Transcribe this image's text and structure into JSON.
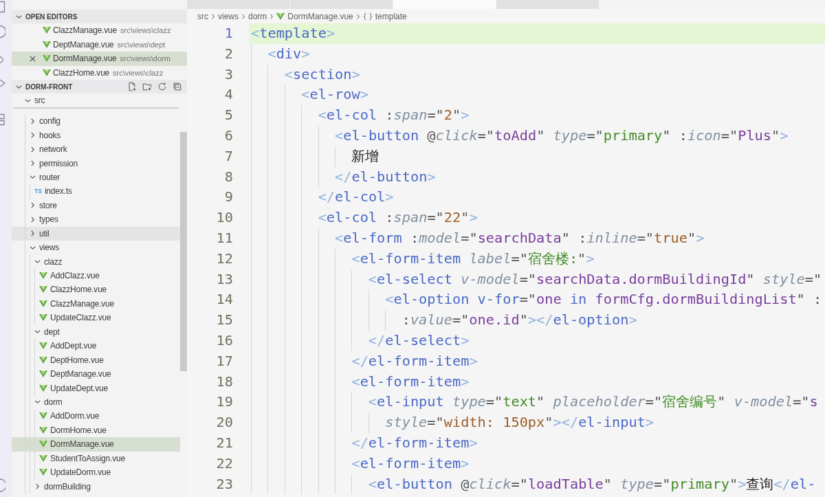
{
  "explorer": {
    "open_editors": {
      "title": "OPEN EDITORS",
      "expanded": true,
      "items": [
        {
          "kind": "vue",
          "name": "ClazzManage.vue",
          "path": "src\\views\\clazz",
          "selected": false
        },
        {
          "kind": "vue",
          "name": "DeptManage.vue",
          "path": "src\\views\\dept",
          "selected": false
        },
        {
          "kind": "vue",
          "name": "DormManage.vue",
          "path": "src\\views\\dorm",
          "selected": true
        },
        {
          "kind": "vue",
          "name": "ClazzHome.vue",
          "path": "src\\views\\clazz",
          "selected": false
        }
      ]
    },
    "project": {
      "title": "DORM-FRONT",
      "expanded": true,
      "tree": [
        {
          "kind": "folder",
          "name": "src",
          "expanded": true,
          "selected": false,
          "hovered": false,
          "children": [
            {
              "kind": "folder",
              "name": "config",
              "expanded": false,
              "selected": false,
              "hovered": false
            },
            {
              "kind": "folder",
              "name": "hooks",
              "expanded": false,
              "selected": false,
              "hovered": false
            },
            {
              "kind": "folder",
              "name": "network",
              "expanded": false,
              "selected": false,
              "hovered": false
            },
            {
              "kind": "folder",
              "name": "permission",
              "expanded": false,
              "selected": false,
              "hovered": false
            },
            {
              "kind": "folder",
              "name": "router",
              "expanded": true,
              "selected": false,
              "hovered": false,
              "children": [
                {
                  "kind": "ts",
                  "name": "index.ts",
                  "icon_text": "TS",
                  "selected": false,
                  "hovered": false
                }
              ]
            },
            {
              "kind": "folder",
              "name": "store",
              "expanded": false,
              "selected": false,
              "hovered": false
            },
            {
              "kind": "folder",
              "name": "types",
              "expanded": false,
              "selected": false,
              "hovered": false
            },
            {
              "kind": "folder",
              "name": "util",
              "expanded": false,
              "selected": false,
              "hovered": true
            },
            {
              "kind": "folder",
              "name": "views",
              "expanded": true,
              "selected": false,
              "hovered": false,
              "children": [
                {
                  "kind": "folder",
                  "name": "clazz",
                  "expanded": true,
                  "selected": false,
                  "hovered": false,
                  "children": [
                    {
                      "kind": "vue",
                      "name": "AddClazz.vue",
                      "selected": false,
                      "hovered": false
                    },
                    {
                      "kind": "vue",
                      "name": "ClazzHome.vue",
                      "selected": false,
                      "hovered": false
                    },
                    {
                      "kind": "vue",
                      "name": "ClazzManage.vue",
                      "selected": false,
                      "hovered": false
                    },
                    {
                      "kind": "vue",
                      "name": "UpdateClazz.vue",
                      "selected": false,
                      "hovered": false
                    }
                  ]
                },
                {
                  "kind": "folder",
                  "name": "dept",
                  "expanded": true,
                  "selected": false,
                  "hovered": false,
                  "children": [
                    {
                      "kind": "vue",
                      "name": "AddDept.vue",
                      "selected": false,
                      "hovered": false
                    },
                    {
                      "kind": "vue",
                      "name": "DeptHome.vue",
                      "selected": false,
                      "hovered": false
                    },
                    {
                      "kind": "vue",
                      "name": "DeptManage.vue",
                      "selected": false,
                      "hovered": false
                    },
                    {
                      "kind": "vue",
                      "name": "UpdateDept.vue",
                      "selected": false,
                      "hovered": false
                    }
                  ]
                },
                {
                  "kind": "folder",
                  "name": "dorm",
                  "expanded": true,
                  "selected": false,
                  "hovered": false,
                  "children": [
                    {
                      "kind": "vue",
                      "name": "AddDorm.vue",
                      "selected": false,
                      "hovered": false
                    },
                    {
                      "kind": "vue",
                      "name": "DormHome.vue",
                      "selected": false,
                      "hovered": false
                    },
                    {
                      "kind": "vue",
                      "name": "DormManage.vue",
                      "selected": true,
                      "hovered": false
                    },
                    {
                      "kind": "vue",
                      "name": "StudentToAssign.vue",
                      "selected": false,
                      "hovered": false
                    },
                    {
                      "kind": "vue",
                      "name": "UpdateDorm.vue",
                      "selected": false,
                      "hovered": false
                    }
                  ]
                },
                {
                  "kind": "folder",
                  "name": "dormBuilding",
                  "expanded": false,
                  "selected": false,
                  "hovered": false
                }
              ]
            }
          ]
        }
      ]
    }
  },
  "editor": {
    "tabs": [
      {
        "selected": false
      },
      {
        "selected": false
      },
      {
        "selected": true
      },
      {
        "selected": false
      }
    ],
    "breadcrumbs": [
      {
        "kind": "folder",
        "label": "src"
      },
      {
        "kind": "folder",
        "label": "views"
      },
      {
        "kind": "folder",
        "label": "dorm"
      },
      {
        "kind": "vue",
        "label": "DormManage.vue"
      },
      {
        "kind": "symbol",
        "label": "template"
      }
    ],
    "lines": [
      {
        "number": "1",
        "current": true,
        "tokens": [
          {
            "kind": "bracket",
            "text": "<"
          },
          {
            "kind": "tag",
            "text": "template"
          },
          {
            "kind": "bracket",
            "text": ">"
          }
        ],
        "children": [
          {
            "number": "2",
            "current": false,
            "tokens": [
              {
                "kind": "bracket",
                "text": "<"
              },
              {
                "kind": "tag",
                "text": "div"
              },
              {
                "kind": "bracket",
                "text": ">"
              }
            ],
            "children": [
              {
                "number": "3",
                "current": false,
                "tokens": [
                  {
                    "kind": "bracket",
                    "text": "<"
                  },
                  {
                    "kind": "tag",
                    "text": "section"
                  },
                  {
                    "kind": "bracket",
                    "text": ">"
                  }
                ],
                "children": [
                  {
                    "number": "4",
                    "current": false,
                    "tokens": [
                      {
                        "kind": "bracket",
                        "text": "<"
                      },
                      {
                        "kind": "tag",
                        "text": "el-row"
                      },
                      {
                        "kind": "bracket",
                        "text": ">"
                      }
                    ],
                    "children": [
                      {
                        "number": "5",
                        "current": false,
                        "tokens": [
                          {
                            "kind": "bracket",
                            "text": "<"
                          },
                          {
                            "kind": "tag",
                            "text": "el-col"
                          },
                          {
                            "kind": "operator",
                            "text": " :"
                          },
                          {
                            "kind": "attribute",
                            "text": "span"
                          },
                          {
                            "kind": "operator",
                            "text": "=\""
                          },
                          {
                            "kind": "constant",
                            "text": "2"
                          },
                          {
                            "kind": "operator",
                            "text": "\""
                          },
                          {
                            "kind": "bracket",
                            "text": ">"
                          }
                        ],
                        "children": [
                          {
                            "number": "6",
                            "current": false,
                            "tokens": [
                              {
                                "kind": "bracket",
                                "text": "<"
                              },
                              {
                                "kind": "tag",
                                "text": "el-button"
                              },
                              {
                                "kind": "operator",
                                "text": " @"
                              },
                              {
                                "kind": "attribute",
                                "text": "click"
                              },
                              {
                                "kind": "operator",
                                "text": "=\""
                              },
                              {
                                "kind": "variable",
                                "text": "toAdd"
                              },
                              {
                                "kind": "operator",
                                "text": "\" "
                              },
                              {
                                "kind": "attribute",
                                "text": "type"
                              },
                              {
                                "kind": "operator",
                                "text": "=\""
                              },
                              {
                                "kind": "string",
                                "text": "primary"
                              },
                              {
                                "kind": "operator",
                                "text": "\" :"
                              },
                              {
                                "kind": "attribute",
                                "text": "icon"
                              },
                              {
                                "kind": "operator",
                                "text": "=\""
                              },
                              {
                                "kind": "variable",
                                "text": "Plus"
                              },
                              {
                                "kind": "operator",
                                "text": "\""
                              },
                              {
                                "kind": "bracket",
                                "text": ">"
                              }
                            ],
                            "children": [
                              {
                                "number": "7",
                                "current": false,
                                "tokens": [
                                  {
                                    "kind": "text",
                                    "text": "新增"
                                  }
                                ]
                              }
                            ]
                          },
                          {
                            "number": "8",
                            "current": false,
                            "tokens": [
                              {
                                "kind": "bracket",
                                "text": "</"
                              },
                              {
                                "kind": "tag",
                                "text": "el-button"
                              },
                              {
                                "kind": "bracket",
                                "text": ">"
                              }
                            ]
                          }
                        ]
                      },
                      {
                        "number": "9",
                        "current": false,
                        "tokens": [
                          {
                            "kind": "bracket",
                            "text": "</"
                          },
                          {
                            "kind": "tag",
                            "text": "el-col"
                          },
                          {
                            "kind": "bracket",
                            "text": ">"
                          }
                        ]
                      },
                      {
                        "number": "10",
                        "current": false,
                        "tokens": [
                          {
                            "kind": "bracket",
                            "text": "<"
                          },
                          {
                            "kind": "tag",
                            "text": "el-col"
                          },
                          {
                            "kind": "operator",
                            "text": " :"
                          },
                          {
                            "kind": "attribute",
                            "text": "span"
                          },
                          {
                            "kind": "operator",
                            "text": "=\""
                          },
                          {
                            "kind": "constant",
                            "text": "22"
                          },
                          {
                            "kind": "operator",
                            "text": "\""
                          },
                          {
                            "kind": "bracket",
                            "text": ">"
                          }
                        ],
                        "children": [
                          {
                            "number": "11",
                            "current": false,
                            "tokens": [
                              {
                                "kind": "bracket",
                                "text": "<"
                              },
                              {
                                "kind": "tag",
                                "text": "el-form"
                              },
                              {
                                "kind": "operator",
                                "text": " :"
                              },
                              {
                                "kind": "attribute",
                                "text": "model"
                              },
                              {
                                "kind": "operator",
                                "text": "=\""
                              },
                              {
                                "kind": "variable",
                                "text": "searchData"
                              },
                              {
                                "kind": "operator",
                                "text": "\" :"
                              },
                              {
                                "kind": "attribute",
                                "text": "inline"
                              },
                              {
                                "kind": "operator",
                                "text": "=\""
                              },
                              {
                                "kind": "constant",
                                "text": "true"
                              },
                              {
                                "kind": "operator",
                                "text": "\""
                              },
                              {
                                "kind": "bracket",
                                "text": ">"
                              }
                            ],
                            "children": [
                              {
                                "number": "12",
                                "current": false,
                                "tokens": [
                                  {
                                    "kind": "bracket",
                                    "text": "<"
                                  },
                                  {
                                    "kind": "tag",
                                    "text": "el-form-item"
                                  },
                                  {
                                    "kind": "attribute",
                                    "text": " label"
                                  },
                                  {
                                    "kind": "operator",
                                    "text": "=\""
                                  },
                                  {
                                    "kind": "string",
                                    "text": "宿舍楼:"
                                  },
                                  {
                                    "kind": "operator",
                                    "text": "\""
                                  },
                                  {
                                    "kind": "bracket",
                                    "text": ">"
                                  }
                                ],
                                "children": [
                                  {
                                    "number": "13",
                                    "current": false,
                                    "tokens": [
                                      {
                                        "kind": "bracket",
                                        "text": "<"
                                      },
                                      {
                                        "kind": "tag",
                                        "text": "el-select"
                                      },
                                      {
                                        "kind": "attribute",
                                        "text": " v-model"
                                      },
                                      {
                                        "kind": "operator",
                                        "text": "=\""
                                      },
                                      {
                                        "kind": "variable",
                                        "text": "searchData.dormBuildingId"
                                      },
                                      {
                                        "kind": "operator",
                                        "text": "\" "
                                      },
                                      {
                                        "kind": "attribute",
                                        "text": "style"
                                      },
                                      {
                                        "kind": "operator",
                                        "text": "=\""
                                      }
                                    ],
                                    "children": [
                                      {
                                        "number": "14",
                                        "current": false,
                                        "tokens": [
                                          {
                                            "kind": "bracket",
                                            "text": "<"
                                          },
                                          {
                                            "kind": "tag",
                                            "text": "el-option"
                                          },
                                          {
                                            "kind": "keyword",
                                            "text": " v-for"
                                          },
                                          {
                                            "kind": "operator",
                                            "text": "=\""
                                          },
                                          {
                                            "kind": "variable",
                                            "text": "one"
                                          },
                                          {
                                            "kind": "keyword",
                                            "text": " in "
                                          },
                                          {
                                            "kind": "variable",
                                            "text": "formCfg.dormBuildingList"
                                          },
                                          {
                                            "kind": "operator",
                                            "text": "\" :"
                                          }
                                        ],
                                        "children": [
                                          {
                                            "number": "15",
                                            "current": false,
                                            "tokens": [
                                              {
                                                "kind": "operator",
                                                "text": ":"
                                              },
                                              {
                                                "kind": "attribute",
                                                "text": "value"
                                              },
                                              {
                                                "kind": "operator",
                                                "text": "=\""
                                              },
                                              {
                                                "kind": "variable",
                                                "text": "one.id"
                                              },
                                              {
                                                "kind": "operator",
                                                "text": "\""
                                              },
                                              {
                                                "kind": "bracket",
                                                "text": "></"
                                              },
                                              {
                                                "kind": "tag",
                                                "text": "el-option"
                                              },
                                              {
                                                "kind": "bracket",
                                                "text": ">"
                                              }
                                            ]
                                          }
                                        ]
                                      }
                                    ]
                                  },
                                  {
                                    "number": "16",
                                    "current": false,
                                    "tokens": [
                                      {
                                        "kind": "bracket",
                                        "text": "</"
                                      },
                                      {
                                        "kind": "tag",
                                        "text": "el-select"
                                      },
                                      {
                                        "kind": "bracket",
                                        "text": ">"
                                      }
                                    ]
                                  }
                                ]
                              },
                              {
                                "number": "17",
                                "current": false,
                                "tokens": [
                                  {
                                    "kind": "bracket",
                                    "text": "</"
                                  },
                                  {
                                    "kind": "tag",
                                    "text": "el-form-item"
                                  },
                                  {
                                    "kind": "bracket",
                                    "text": ">"
                                  }
                                ]
                              },
                              {
                                "number": "18",
                                "current": false,
                                "tokens": [
                                  {
                                    "kind": "bracket",
                                    "text": "<"
                                  },
                                  {
                                    "kind": "tag",
                                    "text": "el-form-item"
                                  },
                                  {
                                    "kind": "bracket",
                                    "text": ">"
                                  }
                                ],
                                "children": [
                                  {
                                    "number": "19",
                                    "current": false,
                                    "tokens": [
                                      {
                                        "kind": "bracket",
                                        "text": "<"
                                      },
                                      {
                                        "kind": "tag",
                                        "text": "el-input"
                                      },
                                      {
                                        "kind": "attribute",
                                        "text": " type"
                                      },
                                      {
                                        "kind": "operator",
                                        "text": "=\""
                                      },
                                      {
                                        "kind": "string",
                                        "text": "text"
                                      },
                                      {
                                        "kind": "operator",
                                        "text": "\" "
                                      },
                                      {
                                        "kind": "attribute",
                                        "text": "placeholder"
                                      },
                                      {
                                        "kind": "operator",
                                        "text": "=\""
                                      },
                                      {
                                        "kind": "string",
                                        "text": "宿舍编号"
                                      },
                                      {
                                        "kind": "operator",
                                        "text": "\" "
                                      },
                                      {
                                        "kind": "attribute",
                                        "text": "v-model"
                                      },
                                      {
                                        "kind": "operator",
                                        "text": "=\""
                                      },
                                      {
                                        "kind": "variable",
                                        "text": "s"
                                      }
                                    ],
                                    "children": [
                                      {
                                        "number": "20",
                                        "current": false,
                                        "tokens": [
                                          {
                                            "kind": "attribute",
                                            "text": "style"
                                          },
                                          {
                                            "kind": "operator",
                                            "text": "=\""
                                          },
                                          {
                                            "kind": "constant",
                                            "text": "width: 150px"
                                          },
                                          {
                                            "kind": "operator",
                                            "text": "\""
                                          },
                                          {
                                            "kind": "bracket",
                                            "text": "></"
                                          },
                                          {
                                            "kind": "tag",
                                            "text": "el-input"
                                          },
                                          {
                                            "kind": "bracket",
                                            "text": ">"
                                          }
                                        ]
                                      }
                                    ]
                                  }
                                ]
                              },
                              {
                                "number": "21",
                                "current": false,
                                "tokens": [
                                  {
                                    "kind": "bracket",
                                    "text": "</"
                                  },
                                  {
                                    "kind": "tag",
                                    "text": "el-form-item"
                                  },
                                  {
                                    "kind": "bracket",
                                    "text": ">"
                                  }
                                ]
                              },
                              {
                                "number": "22",
                                "current": false,
                                "tokens": [
                                  {
                                    "kind": "bracket",
                                    "text": "<"
                                  },
                                  {
                                    "kind": "tag",
                                    "text": "el-form-item"
                                  },
                                  {
                                    "kind": "bracket",
                                    "text": ">"
                                  }
                                ],
                                "children": [
                                  {
                                    "number": "23",
                                    "current": false,
                                    "tokens": [
                                      {
                                        "kind": "bracket",
                                        "text": "<"
                                      },
                                      {
                                        "kind": "tag",
                                        "text": "el-button"
                                      },
                                      {
                                        "kind": "operator",
                                        "text": " @"
                                      },
                                      {
                                        "kind": "attribute",
                                        "text": "click"
                                      },
                                      {
                                        "kind": "operator",
                                        "text": "=\""
                                      },
                                      {
                                        "kind": "variable",
                                        "text": "loadTable"
                                      },
                                      {
                                        "kind": "operator",
                                        "text": "\" "
                                      },
                                      {
                                        "kind": "attribute",
                                        "text": "type"
                                      },
                                      {
                                        "kind": "operator",
                                        "text": "=\""
                                      },
                                      {
                                        "kind": "string",
                                        "text": "primary"
                                      },
                                      {
                                        "kind": "operator",
                                        "text": "\""
                                      },
                                      {
                                        "kind": "bracket",
                                        "text": ">"
                                      },
                                      {
                                        "kind": "text",
                                        "text": "查询"
                                      },
                                      {
                                        "kind": "bracket",
                                        "text": "</"
                                      },
                                      {
                                        "kind": "tag",
                                        "text": "el-"
                                      }
                                    ]
                                  }
                                ]
                              }
                            ]
                          }
                        ]
                      }
                    ]
                  }
                ]
              }
            ]
          }
        ]
      }
    ]
  }
}
